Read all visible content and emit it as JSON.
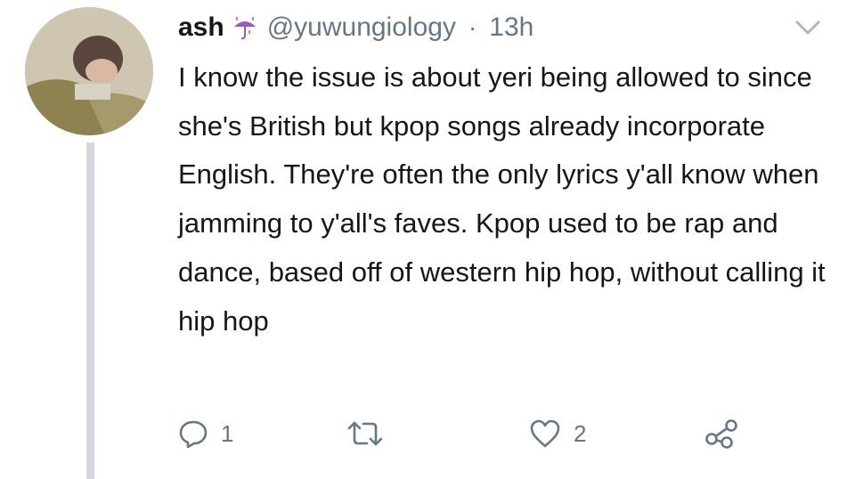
{
  "tweet": {
    "display_name": "ash",
    "name_emoji": "umbrella-with-rain-icon",
    "handle": "@yuwungiology",
    "separator": "·",
    "time": "13h",
    "text": "I know the issue is about yeri being allowed to since she's British but kpop songs already incorporate English. They're often the only lyrics y'all know when jamming to y'all's faves. Kpop used to be rap and dance, based off of western hip hop, without calling it hip hop"
  },
  "actions": {
    "reply_count": "1",
    "retweet_count": "",
    "like_count": "2"
  },
  "colors": {
    "text": "#14171a",
    "secondary": "#657786",
    "thread_line": "#d3d9de",
    "emoji_purple": "#9b59c8"
  },
  "icons": [
    "chevron-down-icon",
    "reply-icon",
    "retweet-icon",
    "like-icon",
    "share-icon"
  ]
}
